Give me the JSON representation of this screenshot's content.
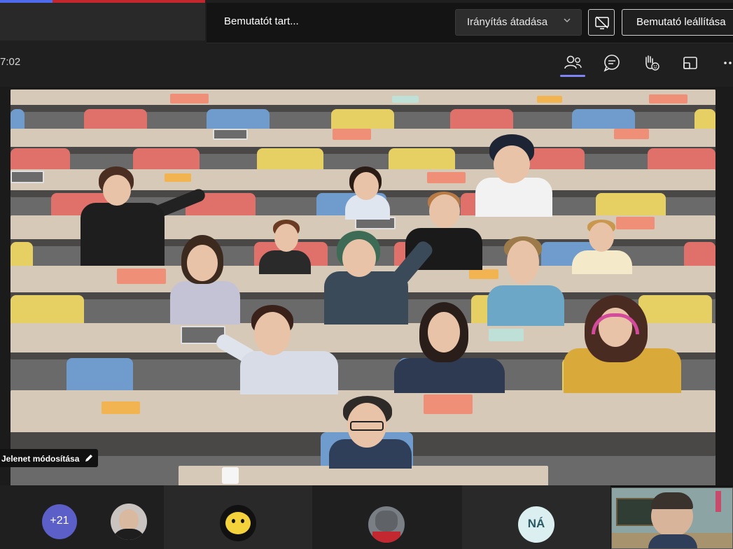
{
  "sharing_bar": {
    "status_text": "Bemutatót tart...",
    "give_control_label": "Irányítás átadása",
    "give_control_icon": "chevron-down-icon",
    "stop_share_icon": "stop-screen-share-icon",
    "stop_presenting_label": "Bemutató leállítása"
  },
  "toolbar": {
    "timer": "7:02",
    "icons": [
      "people-icon",
      "chat-icon",
      "raise-hand-icon",
      "rooms-icon",
      "more-icon"
    ],
    "accent_color": "#7f85f5"
  },
  "stage": {
    "scene_label": "Jelenet módosítása",
    "scene_icon": "pencil-icon",
    "colors": {
      "desk": "#d7c9b7",
      "chair_red": "#e0706a",
      "chair_blue": "#6f9ccc",
      "chair_yellow": "#e6cf63"
    }
  },
  "participants": {
    "overflow_count": "+21",
    "initials": "NÁ",
    "overflow_color": "#5b5fc7"
  }
}
